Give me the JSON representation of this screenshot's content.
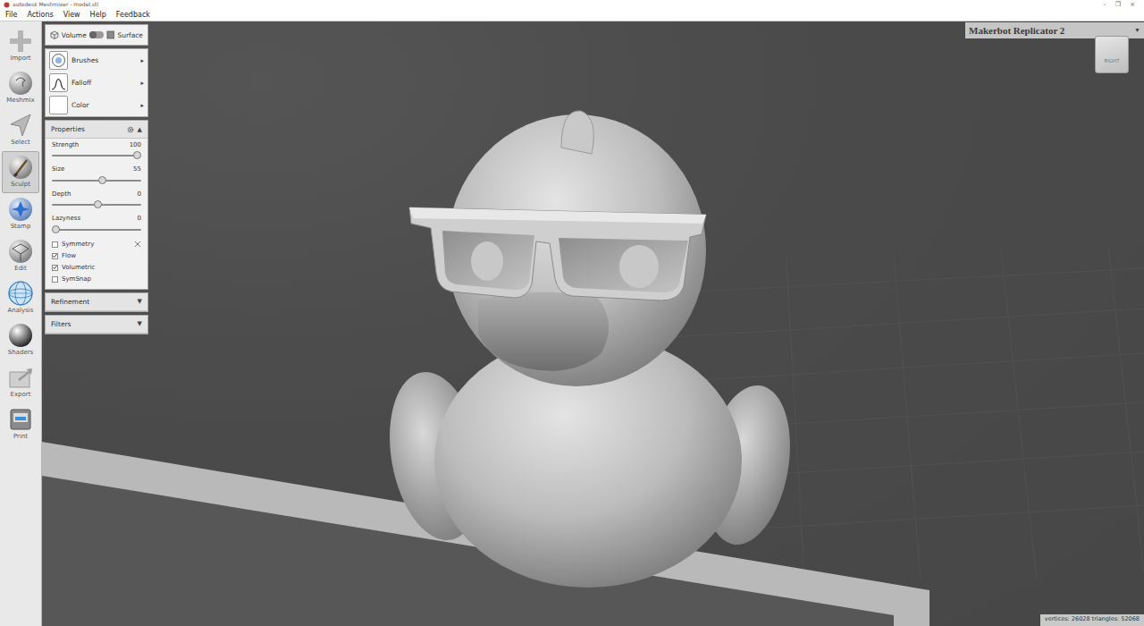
{
  "window": {
    "title": "autodesk Meshmixer - model.stl",
    "controls": [
      "–",
      "❐",
      "×"
    ]
  },
  "menu": [
    "File",
    "Actions",
    "View",
    "Help",
    "Feedback"
  ],
  "tools": [
    {
      "label": "Import",
      "selected": false
    },
    {
      "label": "Meshmix",
      "selected": false
    },
    {
      "label": "Select",
      "selected": false
    },
    {
      "label": "Sculpt",
      "selected": true
    },
    {
      "label": "Stamp",
      "selected": false
    },
    {
      "label": "Edit",
      "selected": false
    },
    {
      "label": "Analysis",
      "selected": false
    },
    {
      "label": "Shaders",
      "selected": false
    },
    {
      "label": "Export",
      "selected": false
    },
    {
      "label": "Print",
      "selected": false
    }
  ],
  "mode_toggle": {
    "left": "Volume",
    "right": "Surface",
    "on": false
  },
  "panel_groups": [
    {
      "label": "Brushes",
      "kind": "brush",
      "arrow": "▸"
    },
    {
      "label": "Falloff",
      "kind": "falloff",
      "arrow": "▸"
    },
    {
      "label": "Color",
      "kind": "color",
      "arrow": "▸"
    }
  ],
  "properties": {
    "title": "Properties",
    "expanded": true,
    "arrow": "▲",
    "sliders": [
      {
        "label": "Strength",
        "reading": "100",
        "level": 1
      },
      {
        "label": "Size",
        "reading": "55",
        "level": 0.57
      },
      {
        "label": "Depth",
        "reading": "0",
        "level": 0.52
      },
      {
        "label": "Lazyness",
        "reading": "0",
        "level": 0
      }
    ],
    "checkboxes": [
      {
        "label": "Symmetry",
        "checked": false
      },
      {
        "label": "Flow",
        "checked": true
      },
      {
        "label": "Volumetric",
        "checked": true
      },
      {
        "label": "SymSnap",
        "checked": false
      }
    ]
  },
  "collapsed_sections": [
    {
      "label": "Refinement",
      "expanded": false,
      "arrow": "▼"
    },
    {
      "label": "Filters",
      "expanded": false,
      "arrow": "▼"
    }
  ],
  "printer": {
    "label": "Makerbot Replicator 2",
    "arrow": "▼"
  },
  "view_cube": {
    "label": "RIGHT"
  },
  "status": "vertices: 26028 triangles: 52068"
}
